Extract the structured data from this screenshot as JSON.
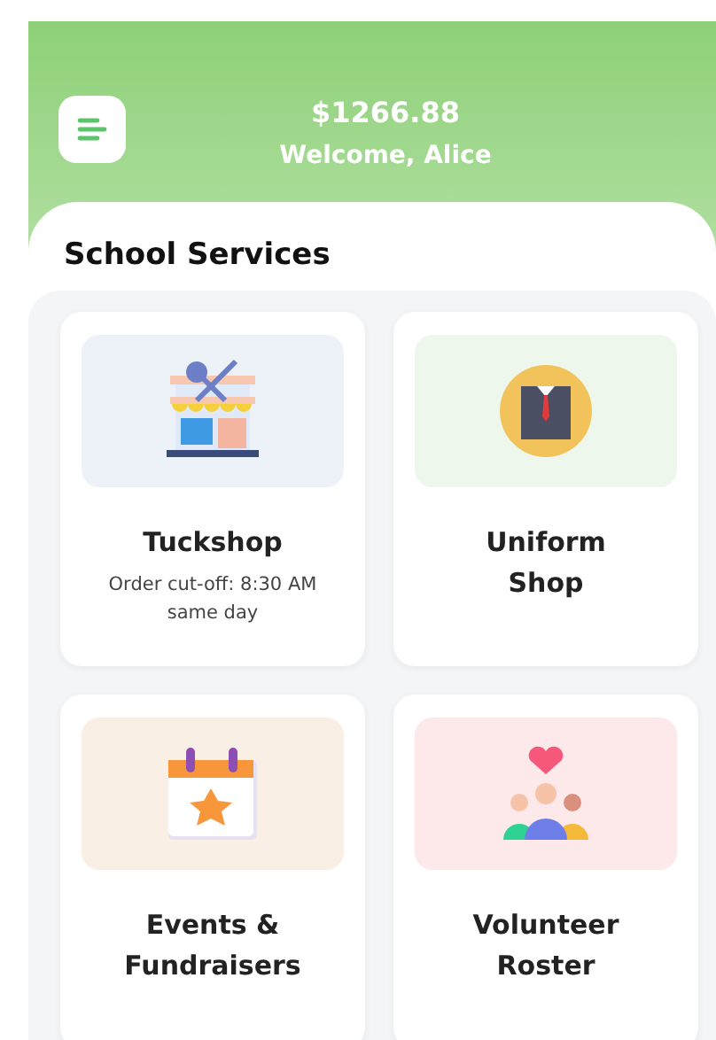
{
  "header": {
    "balance": "$1266.88",
    "greeting": "Welcome, Alice"
  },
  "section": {
    "title": "School Services"
  },
  "services": [
    {
      "kind": "tuckshop",
      "title": "Tuckshop",
      "subtitle": "Order cut-off: 8:30 AM same day",
      "color": "#edf2f9"
    },
    {
      "kind": "uniform",
      "title": "Uniform Shop",
      "color": "#edf7ec"
    },
    {
      "kind": "events",
      "title": "Events & Fundraisers",
      "color": "#f9efe4"
    },
    {
      "kind": "volunteer",
      "title": "Volunteer Roster",
      "color": "#fde8ea"
    }
  ]
}
